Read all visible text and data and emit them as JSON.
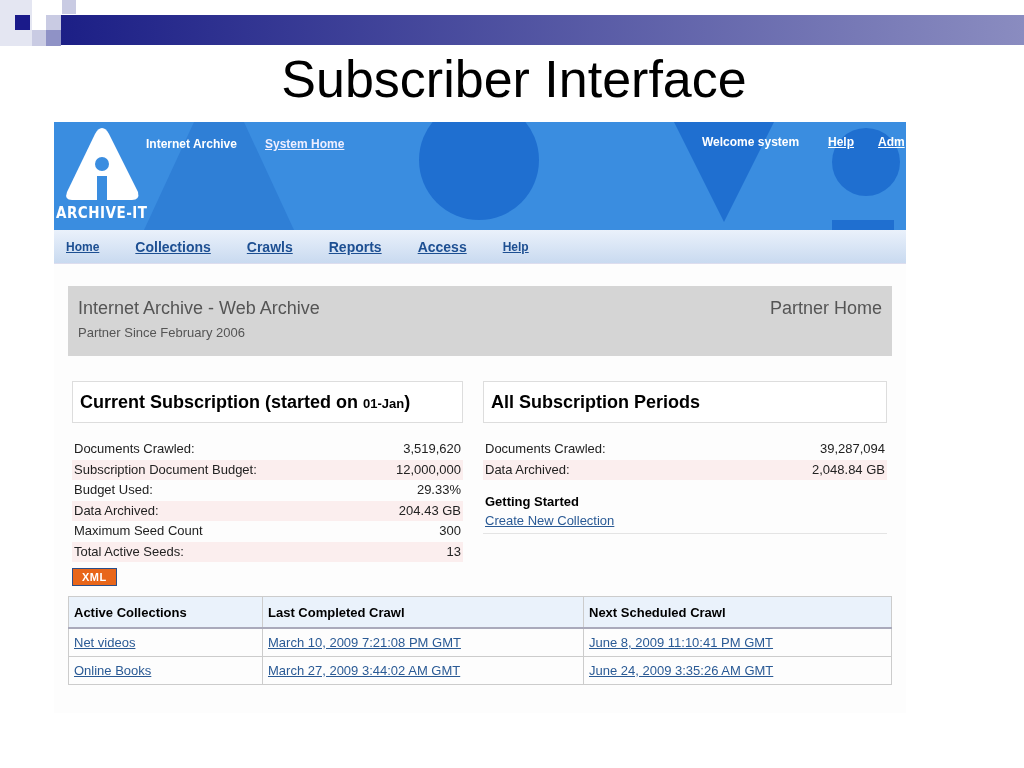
{
  "slide_title": "Subscriber Interface",
  "header": {
    "org": "Internet Archive",
    "system_home": "System Home",
    "welcome": "Welcome system",
    "help": "Help",
    "admin": "Adm",
    "logo_text": "ARCHIVE-IT"
  },
  "nav": [
    {
      "label": "Home"
    },
    {
      "label": "Collections"
    },
    {
      "label": "Crawls"
    },
    {
      "label": "Reports"
    },
    {
      "label": "Access"
    },
    {
      "label": "Help"
    }
  ],
  "partner": {
    "name": "Internet Archive - Web Archive",
    "since": "Partner Since February 2006",
    "home": "Partner Home"
  },
  "current_subscription": {
    "title": "Current Subscription (started on ",
    "start_date": "01-Jan",
    "title_end": ")",
    "rows": [
      {
        "label": "Documents Crawled:",
        "value": "3,519,620"
      },
      {
        "label": "Subscription Document Budget:",
        "value": "12,000,000"
      },
      {
        "label": "Budget Used:",
        "value": "29.33%"
      },
      {
        "label": "Data Archived:",
        "value": "204.43 GB"
      },
      {
        "label": "Maximum Seed Count",
        "value": "300"
      },
      {
        "label": "Total Active Seeds:",
        "value": "13"
      }
    ],
    "xml_badge": "XML"
  },
  "all_periods": {
    "title": "All Subscription Periods",
    "rows": [
      {
        "label": "Documents Crawled:",
        "value": "39,287,094"
      },
      {
        "label": "Data Archived:",
        "value": "2,048.84 GB"
      }
    ],
    "getting_started": "Getting Started",
    "create_link": "Create New Collection"
  },
  "collections_table": {
    "columns": [
      "Active Collections",
      "Last Completed Crawl",
      "Next Scheduled Crawl"
    ],
    "rows": [
      [
        "Net videos",
        "March 10, 2009 7:21:08 PM GMT",
        "June 8, 2009 11:10:41 PM GMT"
      ],
      [
        "Online Books",
        "March 27, 2009 3:44:02 AM GMT",
        "June 24, 2009 3:35:26 AM GMT"
      ]
    ]
  }
}
